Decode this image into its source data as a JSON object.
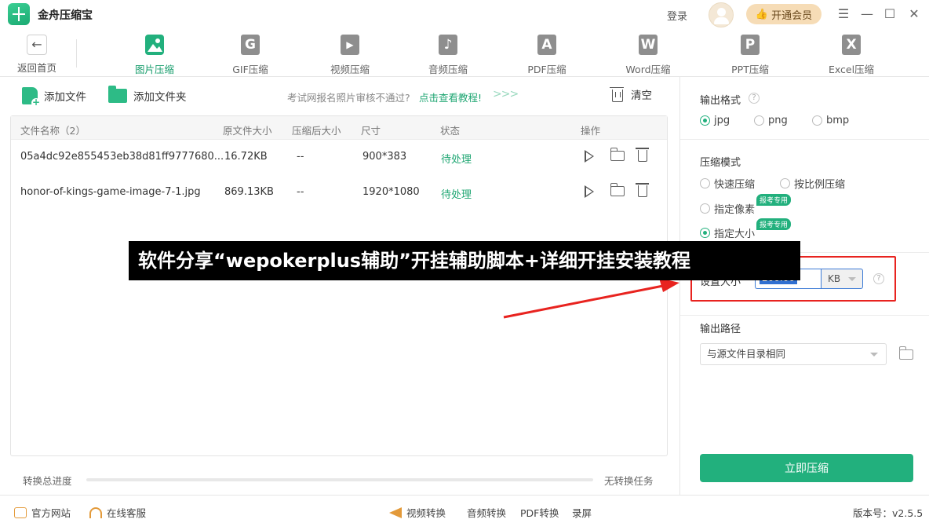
{
  "app": {
    "title": "金舟压缩宝"
  },
  "titlebar": {
    "login": "登录",
    "vip": "开通会员",
    "menu_glyph": "☰",
    "min_glyph": "—",
    "max_glyph": "☐",
    "close_glyph": "✕"
  },
  "toolbar": {
    "back": {
      "arrow": "←",
      "label": "返回首页"
    },
    "items": [
      {
        "label": "图片压缩",
        "icon": "image-compress-icon",
        "active": true
      },
      {
        "label": "GIF压缩",
        "icon": "gif-icon",
        "glyph": "G"
      },
      {
        "label": "视频压缩",
        "icon": "video-icon",
        "glyph": "▶"
      },
      {
        "label": "音频压缩",
        "icon": "audio-icon",
        "glyph": "♪"
      },
      {
        "label": "PDF压缩",
        "icon": "pdf-icon",
        "glyph": "A"
      },
      {
        "label": "Word压缩",
        "icon": "word-icon",
        "glyph": "W"
      },
      {
        "label": "PPT压缩",
        "icon": "ppt-icon",
        "glyph": "P"
      },
      {
        "label": "Excel压缩",
        "icon": "excel-icon",
        "glyph": "X"
      }
    ]
  },
  "actions": {
    "add_file": "添加文件",
    "add_folder": "添加文件夹",
    "tip": "考试网报名照片审核不通过?",
    "tip_link": "点击查看教程!",
    "tip_arrows": ">>>",
    "clear": "清空"
  },
  "table": {
    "headers": [
      "文件名称（2）",
      "原文件大小",
      "压缩后大小",
      "尺寸",
      "状态",
      "操作"
    ],
    "rows": [
      {
        "name": "05a4dc92e855453eb38d81ff9777680...",
        "orig": "16.72KB",
        "after": "--",
        "size": "900*383",
        "status": "待处理"
      },
      {
        "name": "honor-of-kings-game-image-7-1.jpg",
        "orig": "869.13KB",
        "after": "--",
        "size": "1920*1080",
        "status": "待处理"
      }
    ]
  },
  "progress": {
    "label": "转换总进度",
    "value": 0,
    "status": "无转换任务"
  },
  "settings": {
    "format_title": "输出格式",
    "formats": [
      {
        "label": "jpg",
        "checked": true
      },
      {
        "label": "png",
        "checked": false
      },
      {
        "label": "bmp",
        "checked": false
      }
    ],
    "mode_title": "压缩模式",
    "modes": [
      {
        "label": "快速压缩",
        "checked": false
      },
      {
        "label": "按比例压缩",
        "checked": false
      },
      {
        "label": "指定像素",
        "checked": false,
        "tag": "报考专用"
      },
      {
        "label": "指定大小",
        "checked": true,
        "tag": "报考专用"
      }
    ],
    "size_label": "设置大小",
    "size_value": "200.00",
    "size_unit": "KB",
    "path_title": "输出路径",
    "path_value": "与源文件目录相同",
    "start": "立即压缩",
    "help": "?"
  },
  "statusbar": {
    "website": "官方网站",
    "service": "在线客服",
    "links": [
      "视频转换",
      "音频转换",
      "PDF转换",
      "录屏"
    ],
    "version": "版本号：v2.5.5"
  },
  "overlay": {
    "banner": "软件分享“wepokerplus辅助”开挂辅助脚本+详细开挂安装教程"
  },
  "colors": {
    "accent": "#22b07d",
    "vip": "#f6dcb6",
    "annotation": "#e8231f"
  }
}
